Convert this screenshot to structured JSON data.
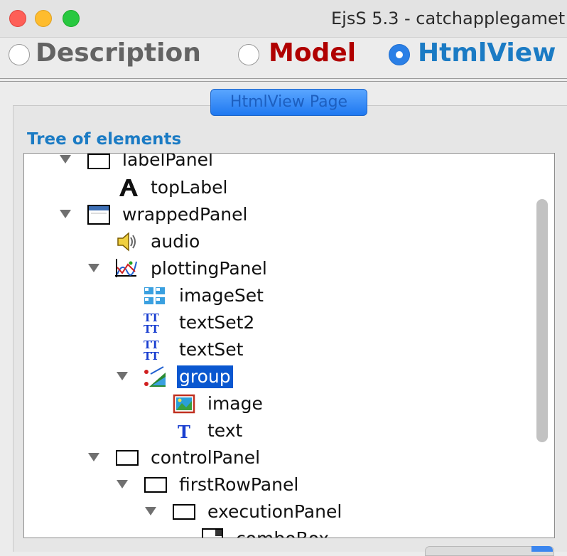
{
  "window": {
    "title": "EjsS 5.3 - catchapplegamet"
  },
  "tabs": [
    {
      "label": "Description",
      "selected": false
    },
    {
      "label": "Model",
      "selected": false
    },
    {
      "label": "HtmlView",
      "selected": true
    }
  ],
  "page_button": {
    "label": "HtmlView Page"
  },
  "tree": {
    "heading": "Tree of elements",
    "items": [
      {
        "label": "labelPanel",
        "icon": "panel-icon",
        "expanded": true
      },
      {
        "label": "topLabel",
        "icon": "label-icon"
      },
      {
        "label": "wrappedPanel",
        "icon": "wrapped-panel-icon",
        "expanded": true
      },
      {
        "label": "audio",
        "icon": "audio-icon"
      },
      {
        "label": "plottingPanel",
        "icon": "plotting-panel-icon",
        "expanded": true
      },
      {
        "label": "imageSet",
        "icon": "image-set-icon"
      },
      {
        "label": "textSet2",
        "icon": "text-set-icon"
      },
      {
        "label": "textSet",
        "icon": "text-set-icon"
      },
      {
        "label": "group",
        "icon": "group-icon",
        "expanded": true,
        "selected": true
      },
      {
        "label": "image",
        "icon": "image-icon"
      },
      {
        "label": "text",
        "icon": "text-icon"
      },
      {
        "label": "controlPanel",
        "icon": "panel-icon",
        "expanded": true
      },
      {
        "label": "firstRowPanel",
        "icon": "panel-icon",
        "expanded": true
      },
      {
        "label": "executionPanel",
        "icon": "panel-icon",
        "expanded": true
      },
      {
        "label": "comboBox",
        "icon": "combobox-icon"
      }
    ]
  },
  "colors": {
    "accent": "#1b7bc4",
    "model_tab": "#b00000",
    "selection": "#0a57d0"
  }
}
